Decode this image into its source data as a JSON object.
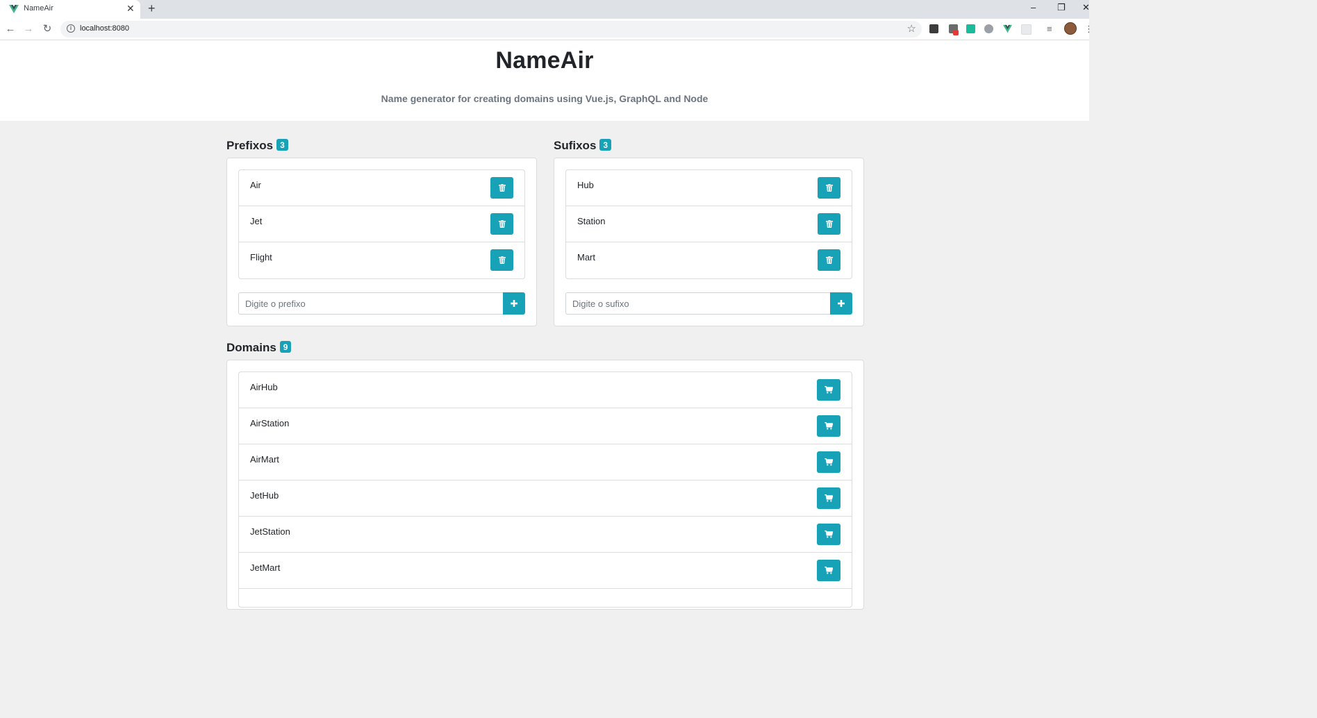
{
  "browser": {
    "tab_title": "NameAir",
    "tab_close": "✕",
    "new_tab": "+",
    "url": "localhost:8080",
    "win_minimize": "–",
    "win_restore": "❐",
    "win_close": "✕"
  },
  "header": {
    "title": "NameAir",
    "subtitle": "Name generator for creating domains using Vue.js, GraphQL and Node"
  },
  "prefixes": {
    "title": "Prefixos",
    "count": "3",
    "items": [
      {
        "label": "Air"
      },
      {
        "label": "Jet"
      },
      {
        "label": "Flight"
      }
    ],
    "input_placeholder": "Digite o prefixo"
  },
  "suffixes": {
    "title": "Sufixos",
    "count": "3",
    "items": [
      {
        "label": "Hub"
      },
      {
        "label": "Station"
      },
      {
        "label": "Mart"
      }
    ],
    "input_placeholder": "Digite o sufixo"
  },
  "domains": {
    "title": "Domains",
    "count": "9",
    "items": [
      {
        "label": "AirHub"
      },
      {
        "label": "AirStation"
      },
      {
        "label": "AirMart"
      },
      {
        "label": "JetHub"
      },
      {
        "label": "JetStation"
      },
      {
        "label": "JetMart"
      }
    ]
  },
  "colors": {
    "accent": "#17a2b8",
    "page_bg": "#f0f0f0"
  },
  "icons": {
    "delete": "trash-icon",
    "add": "plus-icon",
    "buy": "cart-icon"
  }
}
